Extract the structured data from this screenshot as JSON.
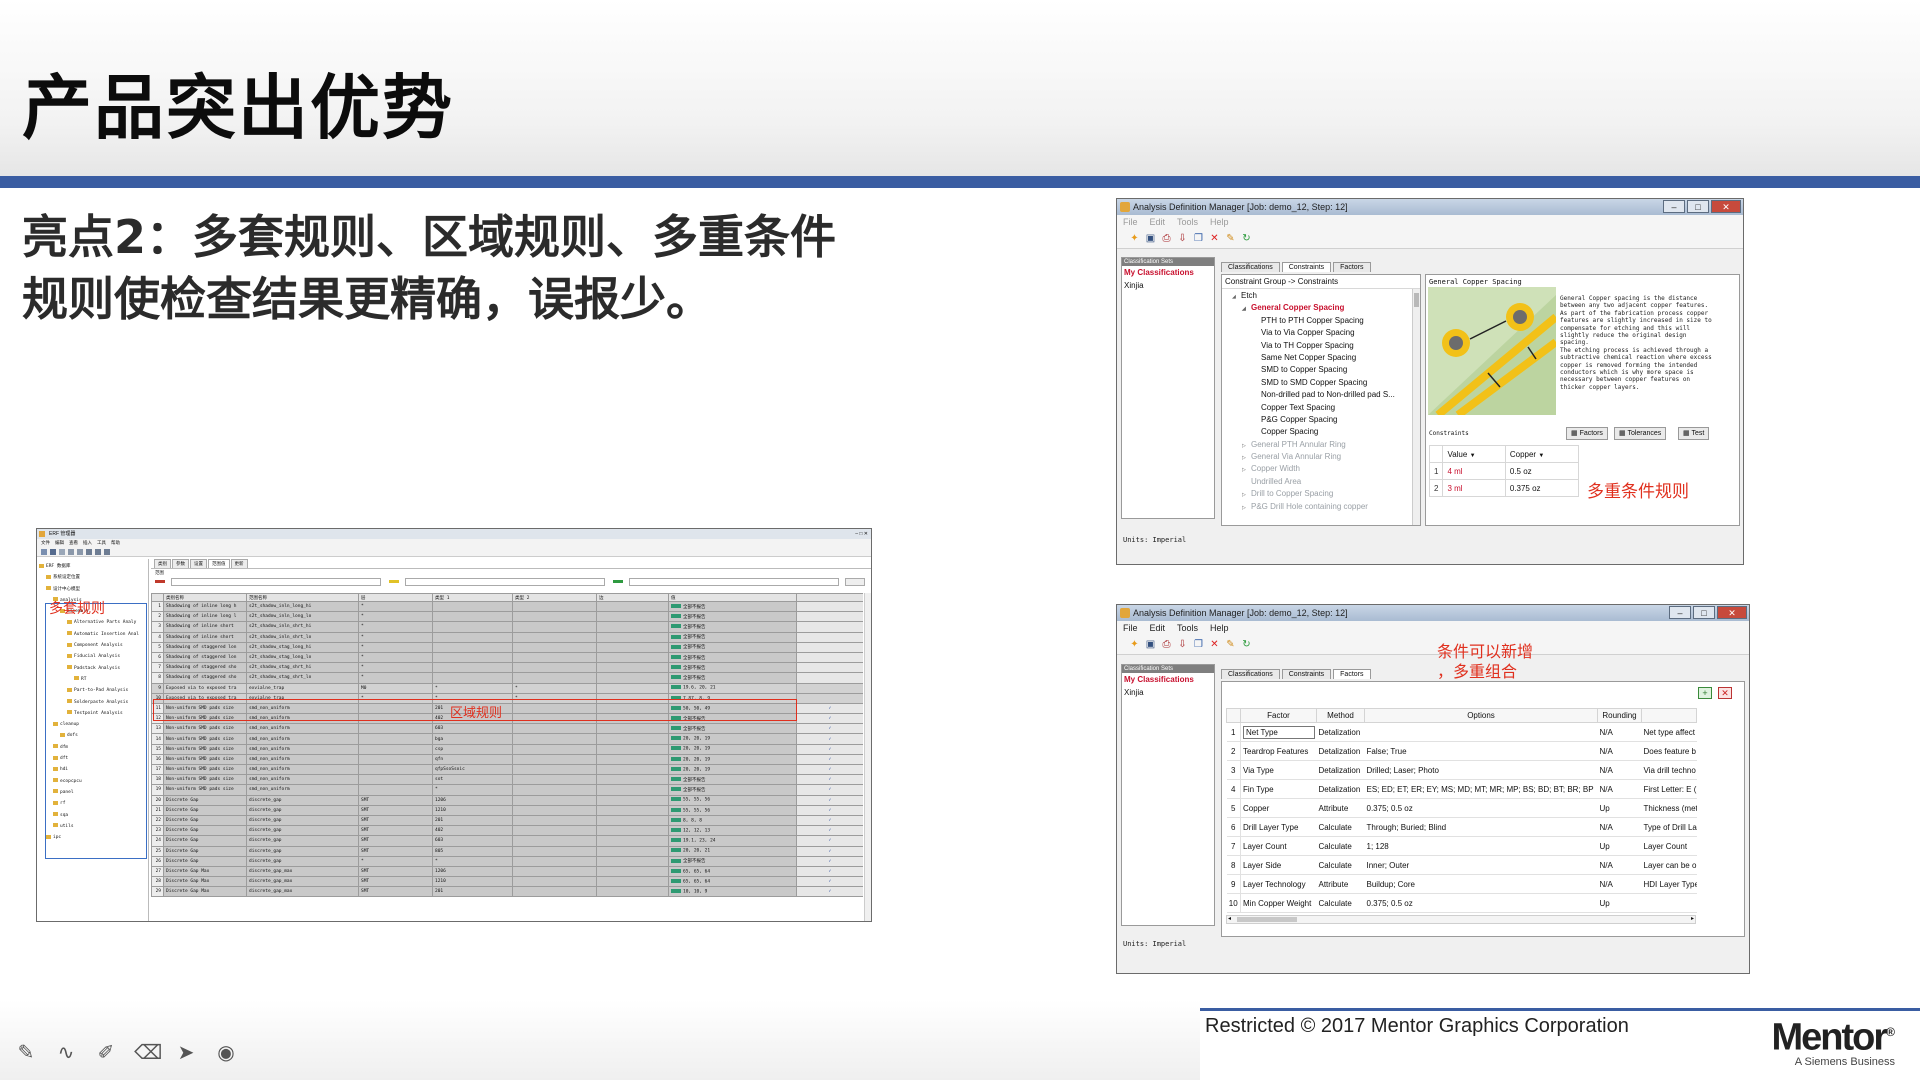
{
  "slide": {
    "title": "产品突出优势",
    "subtitle_line1": "亮点2：多套规则、区域规则、多重条件",
    "subtitle_line2": "规则使检查结果更精确，误报少。",
    "footer": "Restricted © 2017 Mentor Graphics Corporation",
    "logo": "Mentor",
    "logo_sub": "A Siemens Business",
    "accent_color": "#3a5da2"
  },
  "annotations": {
    "multi_condition": "多重条件规则",
    "addable_line1": "条件可以新增",
    "addable_line2": "，多重组合",
    "multi_set": "多套规则",
    "region": "区域规则"
  },
  "window_a": {
    "title": "Analysis Definition Manager [Job: demo_12, Step: 12]",
    "menu": [
      "File",
      "Edit",
      "Tools",
      "Help"
    ],
    "classifications_header": "Classification Sets",
    "my_classifications": "My Classifications",
    "user_item": "Xinjia",
    "tabs": [
      "Classifications",
      "Constraints",
      "Factors"
    ],
    "tree_header": "Constraint Group -> Constraints",
    "tree": [
      {
        "label": "Etch",
        "indent": 1,
        "style": "normal",
        "arrow": "◢"
      },
      {
        "label": "General Copper Spacing",
        "indent": 2,
        "style": "red",
        "arrow": "◢"
      },
      {
        "label": "PTH to PTH Copper Spacing",
        "indent": 3,
        "style": "normal",
        "arrow": ""
      },
      {
        "label": "Via to Via Copper Spacing",
        "indent": 3,
        "style": "normal",
        "arrow": ""
      },
      {
        "label": "Via to TH Copper Spacing",
        "indent": 3,
        "style": "normal",
        "arrow": ""
      },
      {
        "label": "Same Net Copper Spacing",
        "indent": 3,
        "style": "normal",
        "arrow": ""
      },
      {
        "label": "SMD to Copper Spacing",
        "indent": 3,
        "style": "normal",
        "arrow": ""
      },
      {
        "label": "SMD to SMD Copper Spacing",
        "indent": 3,
        "style": "normal",
        "arrow": ""
      },
      {
        "label": "Non-drilled pad to Non-drilled pad S...",
        "indent": 3,
        "style": "normal",
        "arrow": ""
      },
      {
        "label": "Copper Text Spacing",
        "indent": 3,
        "style": "normal",
        "arrow": ""
      },
      {
        "label": "P&G Copper Spacing",
        "indent": 3,
        "style": "normal",
        "arrow": ""
      },
      {
        "label": "Copper Spacing",
        "indent": 3,
        "style": "normal",
        "arrow": ""
      },
      {
        "label": "General PTH Annular Ring",
        "indent": 2,
        "style": "dim",
        "arrow": "▷"
      },
      {
        "label": "General Via Annular Ring",
        "indent": 2,
        "style": "dim",
        "arrow": "▷"
      },
      {
        "label": "Copper Width",
        "indent": 2,
        "style": "dim",
        "arrow": "▷"
      },
      {
        "label": "Undrilled Area",
        "indent": 2,
        "style": "dim",
        "arrow": ""
      },
      {
        "label": "Drill to Copper Spacing",
        "indent": 2,
        "style": "dim",
        "arrow": "▷"
      },
      {
        "label": "P&G Drill Hole containing copper",
        "indent": 2,
        "style": "dim",
        "arrow": "▷"
      }
    ],
    "detail_title": "General Copper Spacing",
    "description": [
      "General Copper spacing is the distance",
      "between any two adjacent copper features.",
      "As part of the fabrication process copper",
      "features are slightly increased in size to",
      "compensate for etching and this will",
      "slightly reduce the original design",
      "spacing.",
      "The etching process is achieved through a",
      "subtractive chemical reaction where excess",
      "copper is removed forming the intended",
      "conductors which is why more space is",
      "necessary between copper features on",
      "thicker copper layers."
    ],
    "constraints_label": "Constraints",
    "buttons": [
      "Factors",
      "Tolerances",
      "Test"
    ],
    "constraint_columns": [
      "Value",
      "Copper"
    ],
    "constraint_rows": [
      {
        "n": "1",
        "value": "4 ml",
        "copper": "0.5 oz"
      },
      {
        "n": "2",
        "value": "3 ml",
        "copper": "0.375 oz"
      }
    ],
    "units": "Units: Imperial"
  },
  "window_b": {
    "title": "Analysis Definition Manager [Job: demo_12, Step: 12]",
    "menu": [
      "File",
      "Edit",
      "Tools",
      "Help"
    ],
    "classifications_header": "Classification Sets",
    "my_classifications": "My Classifications",
    "user_item": "Xinjia",
    "tabs": [
      "Classifications",
      "Constraints",
      "Factors"
    ],
    "columns": [
      "Factor",
      "Method",
      "Options",
      "Rounding",
      ""
    ],
    "rows": [
      {
        "n": "1",
        "factor": "Net Type",
        "method": "Detalization",
        "options": "",
        "rounding": "N/A",
        "desc": "Net type affect"
      },
      {
        "n": "2",
        "factor": "Teardrop Features",
        "method": "Detalization",
        "options": "False; True",
        "rounding": "N/A",
        "desc": "Does feature b"
      },
      {
        "n": "3",
        "factor": "Via Type",
        "method": "Detalization",
        "options": "Drilled; Laser; Photo",
        "rounding": "N/A",
        "desc": "Via drill techno"
      },
      {
        "n": "4",
        "factor": "Fin Type",
        "method": "Detalization",
        "options": "ES; ED; ET; ER; EY; MS; MD; MT; MR; MP; BS; BD; BT; BR; BP",
        "rounding": "N/A",
        "desc": "First Letter: E ("
      },
      {
        "n": "5",
        "factor": "Copper",
        "method": "Attribute",
        "options": "0.375; 0.5 oz",
        "rounding": "Up",
        "desc": "Thickness (met"
      },
      {
        "n": "6",
        "factor": "Drill Layer Type",
        "method": "Calculate",
        "options": "Through; Buried; Blind",
        "rounding": "N/A",
        "desc": "Type of Drill La"
      },
      {
        "n": "7",
        "factor": "Layer Count",
        "method": "Calculate",
        "options": "1; 128",
        "rounding": "Up",
        "desc": "Layer Count"
      },
      {
        "n": "8",
        "factor": "Layer Side",
        "method": "Calculate",
        "options": "Inner; Outer",
        "rounding": "N/A",
        "desc": "Layer can be o"
      },
      {
        "n": "9",
        "factor": "Layer Technology",
        "method": "Attribute",
        "options": "Buildup; Core",
        "rounding": "N/A",
        "desc": "HDI Layer Type"
      },
      {
        "n": "10",
        "factor": "Min Copper Weight",
        "method": "Calculate",
        "options": "0.375; 0.5 oz",
        "rounding": "Up",
        "desc": ""
      }
    ],
    "units": "Units: Imperial"
  },
  "window_c": {
    "title": "ERF 管理器",
    "menu": [
      "文件",
      "编辑",
      "查看",
      "插入",
      "工具",
      "帮助"
    ],
    "tabs": [
      "类别",
      "参数",
      "设置",
      "范围值",
      "更新"
    ],
    "sub_header": "范围",
    "columns": [
      "",
      "类别名称",
      "范围名称",
      "层",
      "类型 1",
      "类型 2",
      "边",
      "值",
      ""
    ],
    "tree": [
      {
        "label": "ERF 数据库",
        "indent": 0
      },
      {
        "label": "系统设定位置",
        "indent": 1
      },
      {
        "label": "设计中心模型",
        "indent": 1
      },
      {
        "label": "analysis",
        "indent": 2
      },
      {
        "label": "assembly",
        "indent": 3
      },
      {
        "label": "Alternative Parts Analy",
        "indent": 4
      },
      {
        "label": "Automatic Insertion Anal",
        "indent": 4
      },
      {
        "label": "Component Analysis",
        "indent": 4
      },
      {
        "label": "Fiducial Analysis",
        "indent": 4
      },
      {
        "label": "Padstack Analysis",
        "indent": 4
      },
      {
        "label": "RT",
        "indent": 5
      },
      {
        "label": "Part-to-Pad Analysis",
        "indent": 4
      },
      {
        "label": "Solderpaste Analysis",
        "indent": 4
      },
      {
        "label": "Testpoint Analysis",
        "indent": 4
      },
      {
        "label": "cleanup",
        "indent": 2
      },
      {
        "label": "dofs",
        "indent": 3
      },
      {
        "label": "dfm",
        "indent": 2
      },
      {
        "label": "dft",
        "indent": 2
      },
      {
        "label": "hdi",
        "indent": 2
      },
      {
        "label": "ecopcpcu",
        "indent": 2
      },
      {
        "label": "panel",
        "indent": 2
      },
      {
        "label": "rf",
        "indent": 2
      },
      {
        "label": "sqa",
        "indent": 2
      },
      {
        "label": "utils",
        "indent": 2
      },
      {
        "label": "ipc",
        "indent": 1
      }
    ],
    "rows": [
      {
        "n": "1",
        "cat": "Shadowing of inline long h",
        "rng": "s2t_shadow_inln_long_hi",
        "lyr": "*",
        "t1": "",
        "t2": "",
        "edge": "",
        "val": "全部不报告",
        "chk": ""
      },
      {
        "n": "2",
        "cat": "Shadowing of inline long l",
        "rng": "s2t_shadow_inln_long_lo",
        "lyr": "*",
        "t1": "",
        "t2": "",
        "edge": "",
        "val": "全部不报告",
        "chk": ""
      },
      {
        "n": "3",
        "cat": "Shadowing of inline short",
        "rng": "s2t_shadow_inln_shrt_hi",
        "lyr": "*",
        "t1": "",
        "t2": "",
        "edge": "",
        "val": "全部不报告",
        "chk": ""
      },
      {
        "n": "4",
        "cat": "Shadowing of inline short",
        "rng": "s2t_shadow_inln_shrt_lo",
        "lyr": "*",
        "t1": "",
        "t2": "",
        "edge": "",
        "val": "全部不报告",
        "chk": ""
      },
      {
        "n": "5",
        "cat": "Shadowing of staggered lon",
        "rng": "s2t_shadow_stag_long_hi",
        "lyr": "*",
        "t1": "",
        "t2": "",
        "edge": "",
        "val": "全部不报告",
        "chk": ""
      },
      {
        "n": "6",
        "cat": "Shadowing of staggered lon",
        "rng": "s2t_shadow_stag_long_lo",
        "lyr": "*",
        "t1": "",
        "t2": "",
        "edge": "",
        "val": "全部不报告",
        "chk": ""
      },
      {
        "n": "7",
        "cat": "Shadowing of staggered sho",
        "rng": "s2t_shadow_stag_shrt_hi",
        "lyr": "*",
        "t1": "",
        "t2": "",
        "edge": "",
        "val": "全部不报告",
        "chk": ""
      },
      {
        "n": "8",
        "cat": "Shadowing of staggered sho",
        "rng": "s2t_shadow_stag_shrt_lo",
        "lyr": "*",
        "t1": "",
        "t2": "",
        "edge": "",
        "val": "全部不报告",
        "chk": ""
      },
      {
        "n": "9",
        "cat": "Exposed via to exposed tra",
        "rng": "exvialne_trap",
        "lyr": "M0",
        "t1": "*",
        "t2": "*",
        "edge": "",
        "val": "19.6,  20,  21",
        "chk": ""
      },
      {
        "n": "10",
        "cat": "Exposed via to exposed tra",
        "rng": "exvialne_trap",
        "lyr": "*",
        "t1": "*",
        "t2": "*",
        "edge": "",
        "val": "7.87,  8,  9",
        "chk": ""
      },
      {
        "n": "11",
        "cat": "Non-uniform SMD pads size",
        "rng": "smd_non_uniform",
        "lyr": "",
        "t1": "201",
        "t2": "",
        "edge": "",
        "val": "50,  50,  49",
        "chk": "✓"
      },
      {
        "n": "12",
        "cat": "Non-uniform SMD pads size",
        "rng": "smd_non_uniform",
        "lyr": "",
        "t1": "402",
        "t2": "",
        "edge": "",
        "val": "全部不报告",
        "chk": "✓"
      },
      {
        "n": "13",
        "cat": "Non-uniform SMD pads size",
        "rng": "smd_non_uniform",
        "lyr": "",
        "t1": "603",
        "t2": "",
        "edge": "",
        "val": "全部不报告",
        "chk": "✓"
      },
      {
        "n": "14",
        "cat": "Non-uniform SMD pads size",
        "rng": "smd_non_uniform",
        "lyr": "",
        "t1": "bga",
        "t2": "",
        "edge": "",
        "val": "20,  20,  19",
        "chk": "✓"
      },
      {
        "n": "15",
        "cat": "Non-uniform SMD pads size",
        "rng": "smd_non_uniform",
        "lyr": "",
        "t1": "csp",
        "t2": "",
        "edge": "",
        "val": "20,  20,  19",
        "chk": "✓"
      },
      {
        "n": "16",
        "cat": "Non-uniform SMD pads size",
        "rng": "smd_non_uniform",
        "lyr": "",
        "t1": "qfn",
        "t2": "",
        "edge": "",
        "val": "20,  20,  19",
        "chk": "✓"
      },
      {
        "n": "17",
        "cat": "Non-uniform SMD pads size",
        "rng": "smd_non_uniform",
        "lyr": "",
        "t1": "qfpSsoSsoic",
        "t2": "",
        "edge": "",
        "val": "20,  20,  19",
        "chk": "✓"
      },
      {
        "n": "18",
        "cat": "Non-uniform SMD pads size",
        "rng": "smd_non_uniform",
        "lyr": "",
        "t1": "sot",
        "t2": "",
        "edge": "",
        "val": "全部不报告",
        "chk": "✓"
      },
      {
        "n": "19",
        "cat": "Non-uniform SMD pads size",
        "rng": "smd_non_uniform",
        "lyr": "",
        "t1": "*",
        "t2": "",
        "edge": "",
        "val": "全部不报告",
        "chk": "✓"
      },
      {
        "n": "20",
        "cat": "Discrete Gap",
        "rng": "discrete_gap",
        "lyr": "SMT",
        "t1": "1206",
        "t2": "",
        "edge": "",
        "val": "55,  55,  56",
        "chk": "✓"
      },
      {
        "n": "21",
        "cat": "Discrete Gap",
        "rng": "discrete_gap",
        "lyr": "SMT",
        "t1": "1210",
        "t2": "",
        "edge": "",
        "val": "55,  55,  56",
        "chk": "✓"
      },
      {
        "n": "22",
        "cat": "Discrete Gap",
        "rng": "discrete_gap",
        "lyr": "SMT",
        "t1": "201",
        "t2": "",
        "edge": "",
        "val": "8,  8,  8",
        "chk": "✓"
      },
      {
        "n": "23",
        "cat": "Discrete Gap",
        "rng": "discrete_gap",
        "lyr": "SMT",
        "t1": "402",
        "t2": "",
        "edge": "",
        "val": "12,  12,  13",
        "chk": "✓"
      },
      {
        "n": "24",
        "cat": "Discrete Gap",
        "rng": "discrete_gap",
        "lyr": "SMT",
        "t1": "603",
        "t2": "",
        "edge": "",
        "val": "19.1,  23,  24",
        "chk": "✓"
      },
      {
        "n": "25",
        "cat": "Discrete Gap",
        "rng": "discrete_gap",
        "lyr": "SMT",
        "t1": "805",
        "t2": "",
        "edge": "",
        "val": "20,  20,  21",
        "chk": "✓"
      },
      {
        "n": "26",
        "cat": "Discrete Gap",
        "rng": "discrete_gap",
        "lyr": "*",
        "t1": "*",
        "t2": "",
        "edge": "",
        "val": "全部不报告",
        "chk": "✓"
      },
      {
        "n": "27",
        "cat": "Discrete Gap Max",
        "rng": "discrete_gap_max",
        "lyr": "SMT",
        "t1": "1206",
        "t2": "",
        "edge": "",
        "val": "65,  65,  64",
        "chk": "✓"
      },
      {
        "n": "28",
        "cat": "Discrete Gap Max",
        "rng": "discrete_gap_max",
        "lyr": "SMT",
        "t1": "1210",
        "t2": "",
        "edge": "",
        "val": "65,  65,  64",
        "chk": "✓"
      },
      {
        "n": "29",
        "cat": "Discrete Gap Max",
        "rng": "discrete_gap_max",
        "lyr": "SMT",
        "t1": "201",
        "t2": "",
        "edge": "",
        "val": "10,  10,  9",
        "chk": "✓"
      }
    ]
  }
}
